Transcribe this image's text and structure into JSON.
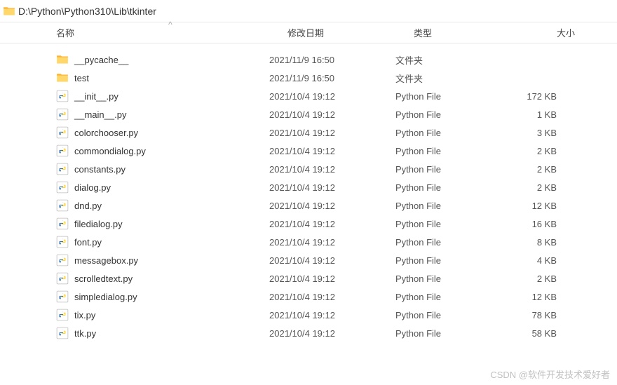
{
  "address": {
    "path": "D:\\Python\\Python310\\Lib\\tkinter"
  },
  "columns": {
    "name": "名称",
    "date": "修改日期",
    "type": "类型",
    "size": "大小",
    "sort_indicator": "^"
  },
  "type_labels": {
    "folder": "文件夹",
    "python": "Python File"
  },
  "rows": [
    {
      "icon": "folder",
      "name": "__pycache__",
      "date": "2021/11/9 16:50",
      "type": "文件夹",
      "size": ""
    },
    {
      "icon": "folder",
      "name": "test",
      "date": "2021/11/9 16:50",
      "type": "文件夹",
      "size": ""
    },
    {
      "icon": "py",
      "name": "__init__.py",
      "date": "2021/10/4 19:12",
      "type": "Python File",
      "size": "172 KB"
    },
    {
      "icon": "py",
      "name": "__main__.py",
      "date": "2021/10/4 19:12",
      "type": "Python File",
      "size": "1 KB"
    },
    {
      "icon": "py",
      "name": "colorchooser.py",
      "date": "2021/10/4 19:12",
      "type": "Python File",
      "size": "3 KB"
    },
    {
      "icon": "py",
      "name": "commondialog.py",
      "date": "2021/10/4 19:12",
      "type": "Python File",
      "size": "2 KB"
    },
    {
      "icon": "py",
      "name": "constants.py",
      "date": "2021/10/4 19:12",
      "type": "Python File",
      "size": "2 KB"
    },
    {
      "icon": "py",
      "name": "dialog.py",
      "date": "2021/10/4 19:12",
      "type": "Python File",
      "size": "2 KB"
    },
    {
      "icon": "py",
      "name": "dnd.py",
      "date": "2021/10/4 19:12",
      "type": "Python File",
      "size": "12 KB"
    },
    {
      "icon": "py",
      "name": "filedialog.py",
      "date": "2021/10/4 19:12",
      "type": "Python File",
      "size": "16 KB"
    },
    {
      "icon": "py",
      "name": "font.py",
      "date": "2021/10/4 19:12",
      "type": "Python File",
      "size": "8 KB"
    },
    {
      "icon": "py",
      "name": "messagebox.py",
      "date": "2021/10/4 19:12",
      "type": "Python File",
      "size": "4 KB"
    },
    {
      "icon": "py",
      "name": "scrolledtext.py",
      "date": "2021/10/4 19:12",
      "type": "Python File",
      "size": "2 KB"
    },
    {
      "icon": "py",
      "name": "simpledialog.py",
      "date": "2021/10/4 19:12",
      "type": "Python File",
      "size": "12 KB"
    },
    {
      "icon": "py",
      "name": "tix.py",
      "date": "2021/10/4 19:12",
      "type": "Python File",
      "size": "78 KB"
    },
    {
      "icon": "py",
      "name": "ttk.py",
      "date": "2021/10/4 19:12",
      "type": "Python File",
      "size": "58 KB"
    }
  ],
  "watermark": "CSDN @软件开发技术爱好者"
}
